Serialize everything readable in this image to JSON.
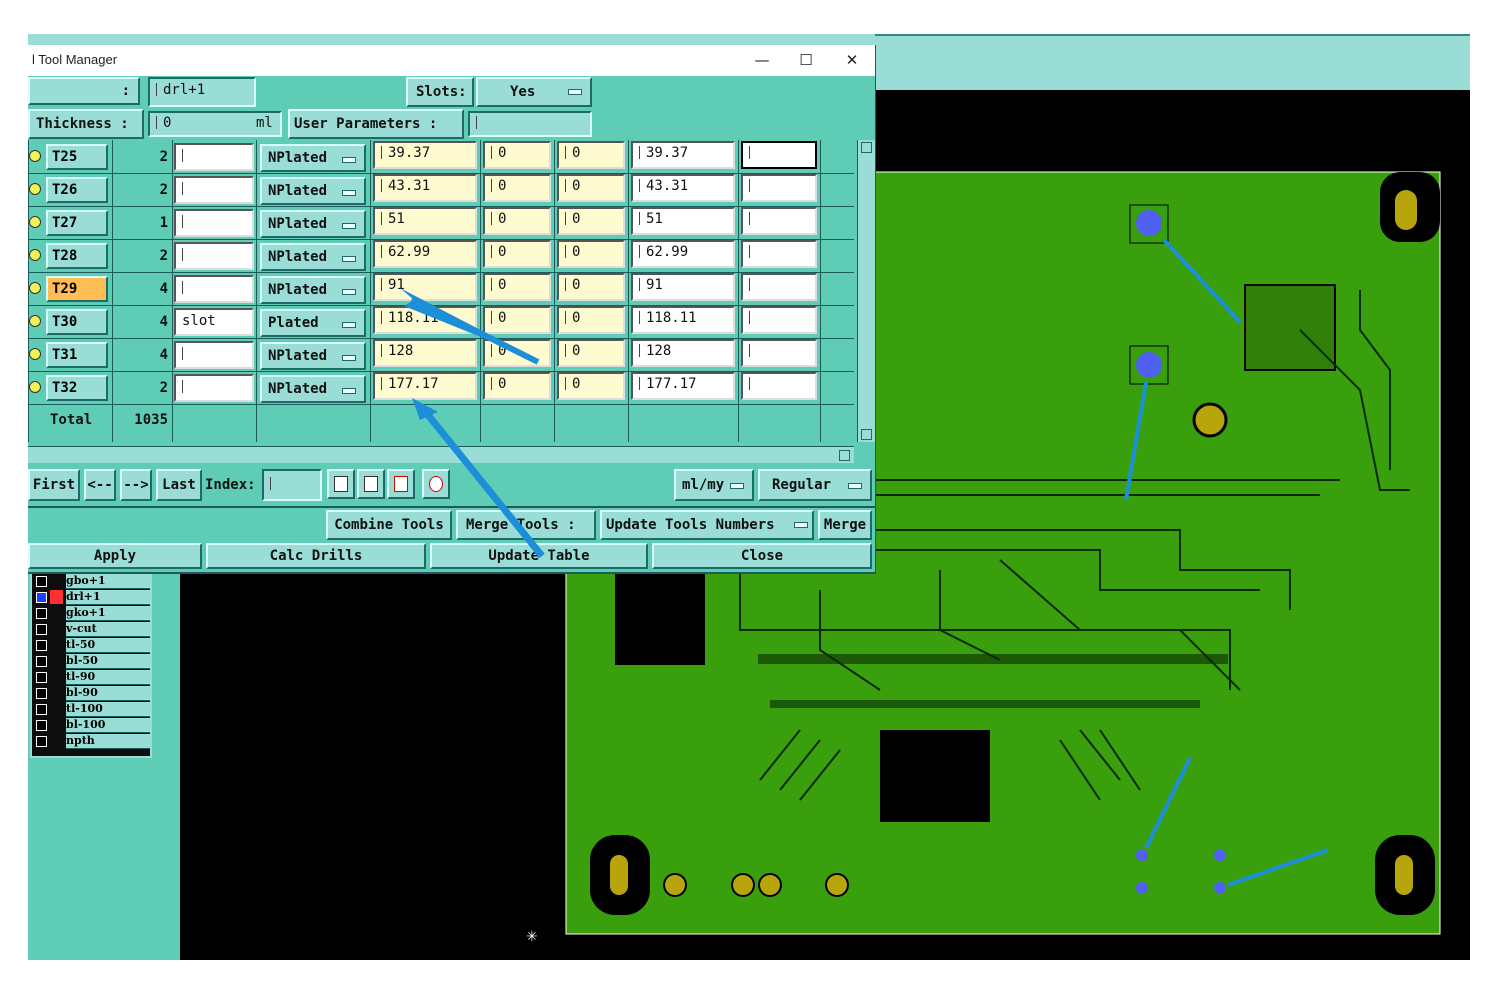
{
  "dialog": {
    "title": "l Tool Manager",
    "window_controls": {
      "minimize": "—",
      "maximize": "☐",
      "close": "✕"
    },
    "layer_label": ":",
    "layer_value": "drl+1",
    "slots_label": "Slots:",
    "slots_value": "Yes",
    "thickness_label": "Thickness :",
    "thickness_value": "0",
    "thickness_unit": "ml",
    "user_params_label": "User Parameters :",
    "user_params_value": ""
  },
  "table": {
    "rows": [
      {
        "tool": "T25",
        "count": "2",
        "type_text": "",
        "plating": "NPlated",
        "finish": "39.37",
        "p1": "0",
        "p2": "0",
        "drill": "39.37",
        "extra": ""
      },
      {
        "tool": "T26",
        "count": "2",
        "type_text": "",
        "plating": "NPlated",
        "finish": "43.31",
        "p1": "0",
        "p2": "0",
        "drill": "43.31",
        "extra": ""
      },
      {
        "tool": "T27",
        "count": "1",
        "type_text": "",
        "plating": "NPlated",
        "finish": "51",
        "p1": "0",
        "p2": "0",
        "drill": "51",
        "extra": ""
      },
      {
        "tool": "T28",
        "count": "2",
        "type_text": "",
        "plating": "NPlated",
        "finish": "62.99",
        "p1": "0",
        "p2": "0",
        "drill": "62.99",
        "extra": ""
      },
      {
        "tool": "T29",
        "count": "4",
        "type_text": "",
        "plating": "NPlated",
        "finish": "91",
        "p1": "0",
        "p2": "0",
        "drill": "91",
        "extra": ""
      },
      {
        "tool": "T30",
        "count": "4",
        "type_text": "slot",
        "plating": "Plated",
        "finish": "118.11",
        "p1": "0",
        "p2": "0",
        "drill": "118.11",
        "extra": ""
      },
      {
        "tool": "T31",
        "count": "4",
        "type_text": "",
        "plating": "NPlated",
        "finish": "128",
        "p1": "0",
        "p2": "0",
        "drill": "128",
        "extra": ""
      },
      {
        "tool": "T32",
        "count": "2",
        "type_text": "",
        "plating": "NPlated",
        "finish": "177.17",
        "p1": "0",
        "p2": "0",
        "drill": "177.17",
        "extra": ""
      }
    ],
    "total_label": "Total",
    "total_value": "1035"
  },
  "nav": {
    "first": "First",
    "prev": "<--",
    "next": "-->",
    "last": "Last",
    "index_label": "Index:",
    "index_value": "",
    "units": "ml/my",
    "mode": "Regular"
  },
  "actions": {
    "combine": "Combine Tools",
    "merge_tools_label": "Merge Tools :",
    "update_numbers": "Update Tools Numbers",
    "merge": "Merge",
    "apply": "Apply",
    "calc": "Calc Drills",
    "update_table": "Update Table",
    "close": "Close"
  },
  "layers": [
    "gbo+1",
    "drl+1",
    "gko+1",
    "v-cut",
    "tl-50",
    "bl-50",
    "tl-90",
    "bl-90",
    "tl-100",
    "bl-100",
    "npth"
  ],
  "colors": {
    "dialog_bg": "#5fcdb6",
    "field_bg": "#9adcd6",
    "selected_tool": "#ffbe55",
    "pcb_green": "#3a9f0c",
    "drill_highlight": "#5060f0",
    "annotation_arrow": "#1d8ed8"
  }
}
